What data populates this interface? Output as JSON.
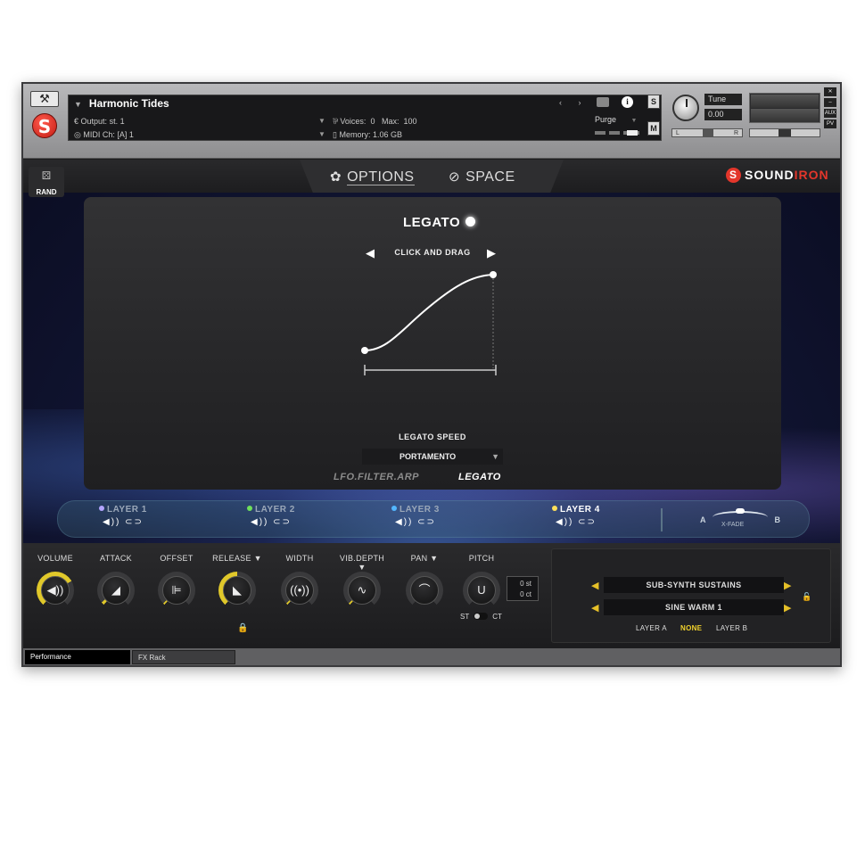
{
  "header": {
    "instrument_name": "Harmonic Tides",
    "output_label": "Output:",
    "output_value": "st. 1",
    "midi_label": "MIDI Ch:",
    "midi_value": "[A]  1",
    "voices_label": "Voices:",
    "voices_value": "0",
    "max_label": "Max:",
    "max_value": "100",
    "memory_label": "Memory:",
    "memory_value": "1.06 GB",
    "purge_label": "Purge",
    "solo_label": "S",
    "mute_label": "M",
    "tune_label": "Tune",
    "tune_value": "0.00",
    "pan_left": "L",
    "pan_right": "R",
    "aux_label": "AUX",
    "pv_label": "PV"
  },
  "topbar": {
    "rand_label": "RAND",
    "tabs": [
      {
        "label": "OPTIONS",
        "icon": "gear-icon",
        "active": true
      },
      {
        "label": "SPACE",
        "icon": "planet-icon",
        "active": false
      }
    ],
    "brand_sound": "SOUND",
    "brand_iron": "IRON"
  },
  "legato": {
    "title": "LEGATO",
    "curve_hint": "CLICK AND DRAG",
    "speed_label": "LEGATO SPEED",
    "speed_value": "PORTAMENTO",
    "subtabs": [
      "LFO.FILTER.ARP",
      "LEGATO"
    ]
  },
  "layers": [
    {
      "label": "LAYER 1",
      "dot_color": "#b4a5ff",
      "active": false
    },
    {
      "label": "LAYER 2",
      "dot_color": "#6fe05a",
      "active": false
    },
    {
      "label": "LAYER 3",
      "dot_color": "#53b7ff",
      "active": false
    },
    {
      "label": "LAYER 4",
      "dot_color": "#ffe15a",
      "active": true
    }
  ],
  "xfade": {
    "a": "A",
    "b": "B",
    "label": "X-FADE"
  },
  "controls": [
    {
      "label": "VOLUME",
      "icon": "speaker-icon",
      "glyph": "◀))",
      "fill": "200deg"
    },
    {
      "label": "ATTACK",
      "icon": "ramp-up-icon",
      "glyph": "◢",
      "fill": "10deg"
    },
    {
      "label": "OFFSET",
      "icon": "offset-icon",
      "glyph": "⊫",
      "fill": "5deg"
    },
    {
      "label": "RELEASE ▼",
      "icon": "ramp-down-icon",
      "glyph": "◣",
      "fill": "140deg"
    },
    {
      "label": "WIDTH",
      "icon": "stereo-width-icon",
      "glyph": "((•))",
      "fill": "5deg"
    },
    {
      "label": "VIB.DEPTH ▼",
      "icon": "sine-wave-icon",
      "glyph": "∿",
      "fill": "5deg"
    },
    {
      "label": "PAN  ▼",
      "icon": "pan-arc-icon",
      "glyph": "⌒",
      "fill": "0deg"
    },
    {
      "label": "PITCH",
      "icon": "tuning-fork-icon",
      "glyph": "U",
      "fill": "0deg"
    }
  ],
  "pitch": {
    "st_value": "0 st",
    "ct_value": "0 ct",
    "st_label": "ST",
    "ct_label": "CT"
  },
  "preset": {
    "patch_1": "SUB-SYNTH SUSTAINS",
    "patch_2": "SINE WARM 1",
    "layer_a": "LAYER A",
    "none": "NONE",
    "layer_b": "LAYER B"
  },
  "bottom_tabs": [
    "Performance",
    "FX Rack"
  ],
  "colors": {
    "accent": "#e0c82a",
    "brand_red": "#e3362b"
  }
}
